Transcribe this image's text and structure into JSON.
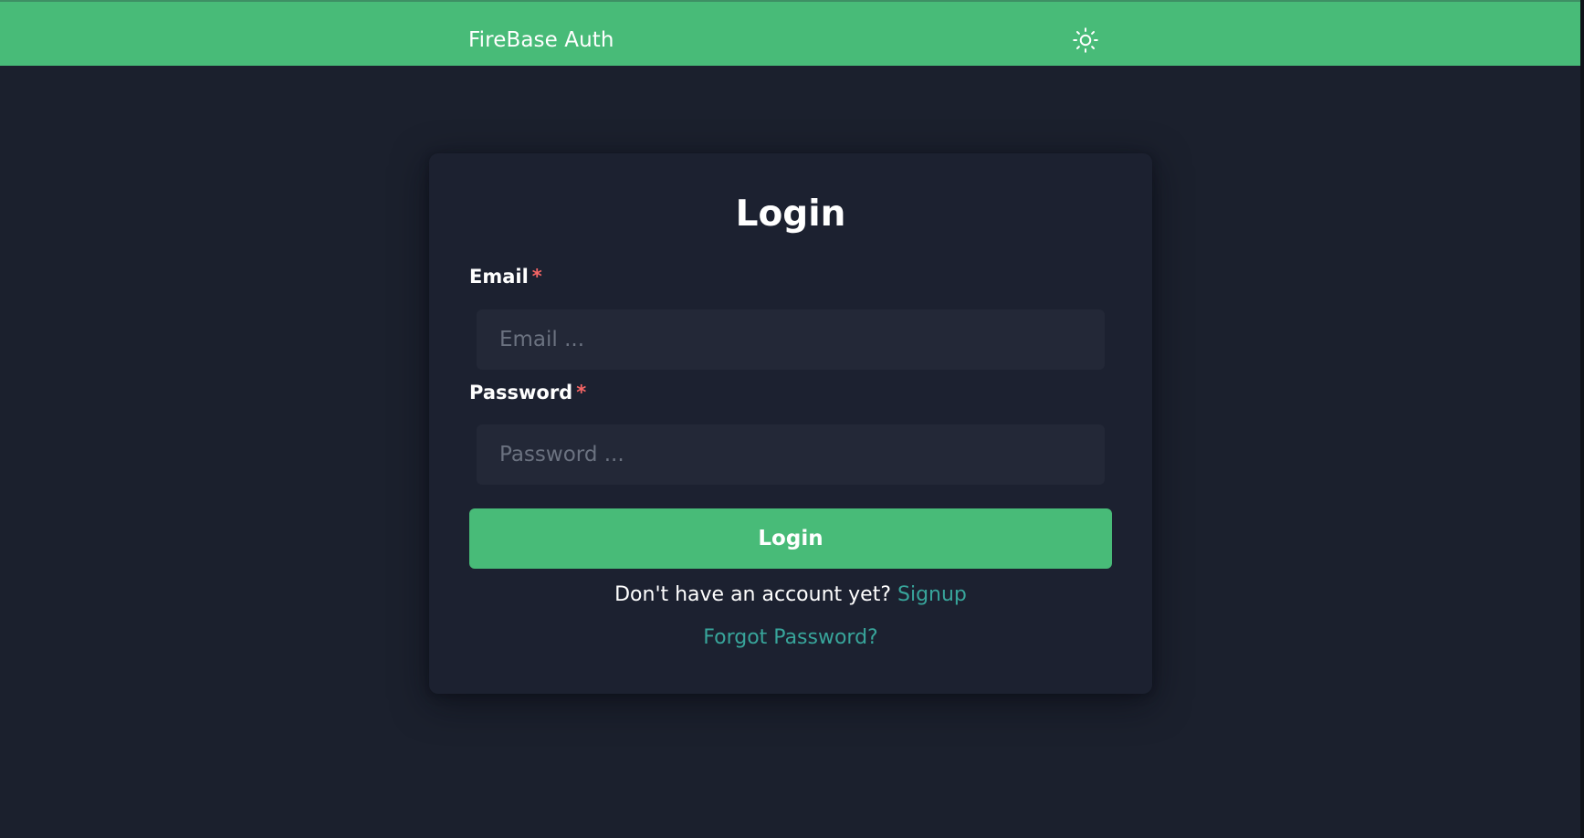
{
  "navbar": {
    "brand": "FireBase Auth",
    "theme_icon": "sun-icon"
  },
  "colors": {
    "accent": "#48bb78",
    "background": "#1b202d",
    "card": "#1c2130",
    "input": "#232837",
    "required": "#f56565",
    "link": "#38a59b"
  },
  "form": {
    "title": "Login",
    "email": {
      "label": "Email",
      "required_mark": "*",
      "value": "",
      "placeholder": "Email ..."
    },
    "password": {
      "label": "Password",
      "required_mark": "*",
      "value": "",
      "placeholder": "Password ..."
    },
    "submit_label": "Login",
    "signup_prompt": "Don't have an account yet?",
    "signup_link": "Signup",
    "forgot_link": "Forgot Password?"
  }
}
